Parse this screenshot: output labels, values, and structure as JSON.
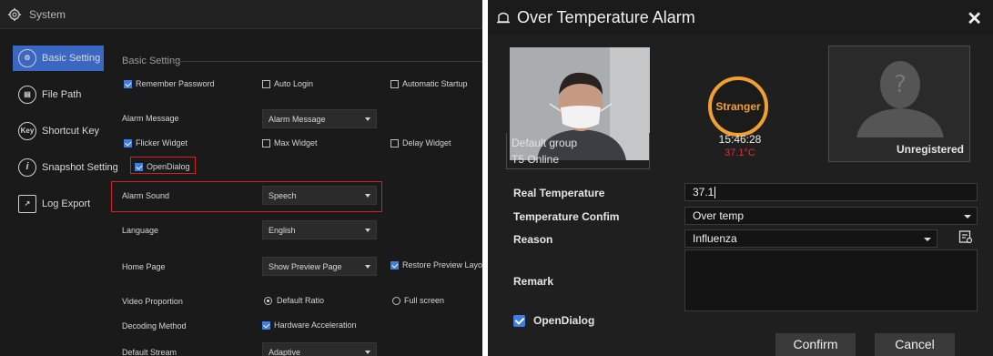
{
  "system": {
    "title": "System",
    "sidebar": [
      {
        "label": "Basic Setting",
        "icon": "gear-circle-icon",
        "active": true
      },
      {
        "label": "File Path",
        "icon": "file-circle-icon",
        "active": false
      },
      {
        "label": "Shortcut Key",
        "icon": "key-circle-icon",
        "active": false
      },
      {
        "label": "Snapshot Setting",
        "icon": "info-circle-icon",
        "active": false
      },
      {
        "label": "Log Export",
        "icon": "export-icon",
        "active": false
      }
    ],
    "section_title": "Basic Setting",
    "remember_password": "Remember Password",
    "auto_login": "Auto Login",
    "automatic_startup": "Automatic Startup",
    "alarm_message_label": "Alarm Message",
    "alarm_message_value": "Alarm Message",
    "flicker_widget": "Flicker Widget",
    "max_widget": "Max Widget",
    "delay_widget": "Delay Widget",
    "open_dialog": "OpenDialog",
    "alarm_sound_label": "Alarm Sound",
    "alarm_sound_value": "Speech",
    "language_label": "Language",
    "language_value": "English",
    "home_page_label": "Home Page",
    "home_page_value": "Show Preview Page",
    "restore_preview_layout": "Restore Preview Layout",
    "video_proportion_label": "Video Proportion",
    "default_ratio": "Default Ratio",
    "full_screen": "Full screen",
    "decoding_method_label": "Decoding Method",
    "hardware_acceleration": "Hardware Acceleration",
    "default_stream_label": "Default Stream",
    "default_stream_value": "Adaptive"
  },
  "alarm": {
    "title": "Over Temperature Alarm",
    "close": "✕",
    "group": "Default group",
    "device": "T5 Online",
    "badge": "Stranger",
    "time": "15:46:28",
    "temperature": "37.1°C",
    "unregistered": "Unregistered",
    "real_temp_label": "Real Temperature",
    "real_temp_value": "37.1",
    "temp_confirm_label": "Temperature Confim",
    "temp_confirm_value": "Over temp",
    "reason_label": "Reason",
    "reason_value": "Influenza",
    "remark_label": "Remark",
    "open_dialog": "OpenDialog",
    "confirm": "Confirm",
    "cancel": "Cancel"
  },
  "colors": {
    "accent": "#3a67c4",
    "highlight": "#d02020",
    "stranger": "#f0a030",
    "temp": "#e03030"
  }
}
